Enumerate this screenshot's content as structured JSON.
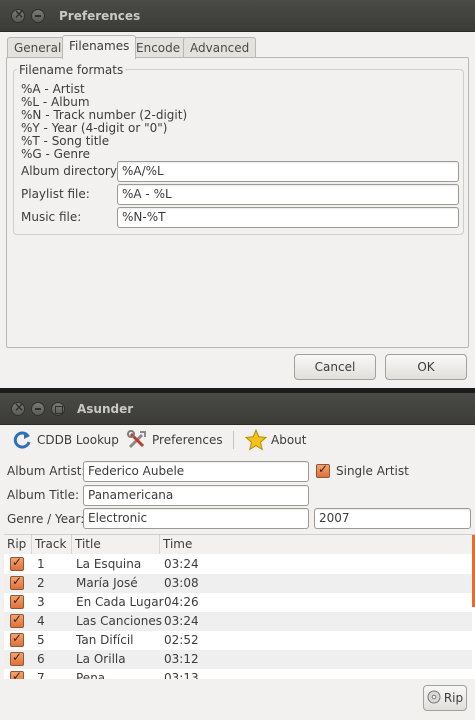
{
  "preferences": {
    "title": "Preferences",
    "tabs": [
      {
        "label": "General"
      },
      {
        "label": "Filenames",
        "active": true
      },
      {
        "label": "Encode"
      },
      {
        "label": "Advanced"
      }
    ],
    "frame_label": "Filename formats",
    "format_lines": [
      "%A - Artist",
      "%L - Album",
      "%N - Track number (2-digit)",
      "%Y - Year (4-digit or \"0\")",
      "%T - Song title",
      "%G - Genre"
    ],
    "fields": {
      "album_directory": {
        "label": "Album directory:",
        "value": "%A/%L"
      },
      "playlist_file": {
        "label": "Playlist file:",
        "value": "%A - %L"
      },
      "music_file": {
        "label": "Music file:",
        "value": "%N-%T"
      }
    },
    "cancel_label": "Cancel",
    "ok_label": "OK"
  },
  "asunder": {
    "title": "Asunder",
    "toolbar": {
      "cddb_label": "CDDB Lookup",
      "prefs_label": "Preferences",
      "about_label": "About"
    },
    "album_artist": {
      "label": "Album Artist:",
      "value": "Federico Aubele"
    },
    "single_artist": {
      "label": "Single Artist",
      "checked": true
    },
    "album_title": {
      "label": "Album Title:",
      "value": "Panamericana"
    },
    "genre_year": {
      "label": "Genre / Year:",
      "genre": "Electronic",
      "year": "2007"
    },
    "columns": [
      "Rip",
      "Track",
      "Title",
      "Time"
    ],
    "tracks": [
      {
        "rip": true,
        "track": "1",
        "title": "La Esquina",
        "time": "03:24"
      },
      {
        "rip": true,
        "track": "2",
        "title": "María José",
        "time": "03:08"
      },
      {
        "rip": true,
        "track": "3",
        "title": "En Cada Lugar",
        "time": "04:26"
      },
      {
        "rip": true,
        "track": "4",
        "title": "Las Canciones",
        "time": "03:24"
      },
      {
        "rip": true,
        "track": "5",
        "title": "Tan Difícil",
        "time": "02:52"
      },
      {
        "rip": true,
        "track": "6",
        "title": "La Orilla",
        "time": "03:12"
      },
      {
        "rip": true,
        "track": "7",
        "title": "Pena",
        "time": "03:13"
      }
    ],
    "rip_label": "Rip"
  },
  "colors": {
    "titlebar": "#3b3b38",
    "window_bg": "#f2f1f0",
    "checkbox_accent": "#e1703a",
    "scroll_accent": "#e86a2e"
  }
}
